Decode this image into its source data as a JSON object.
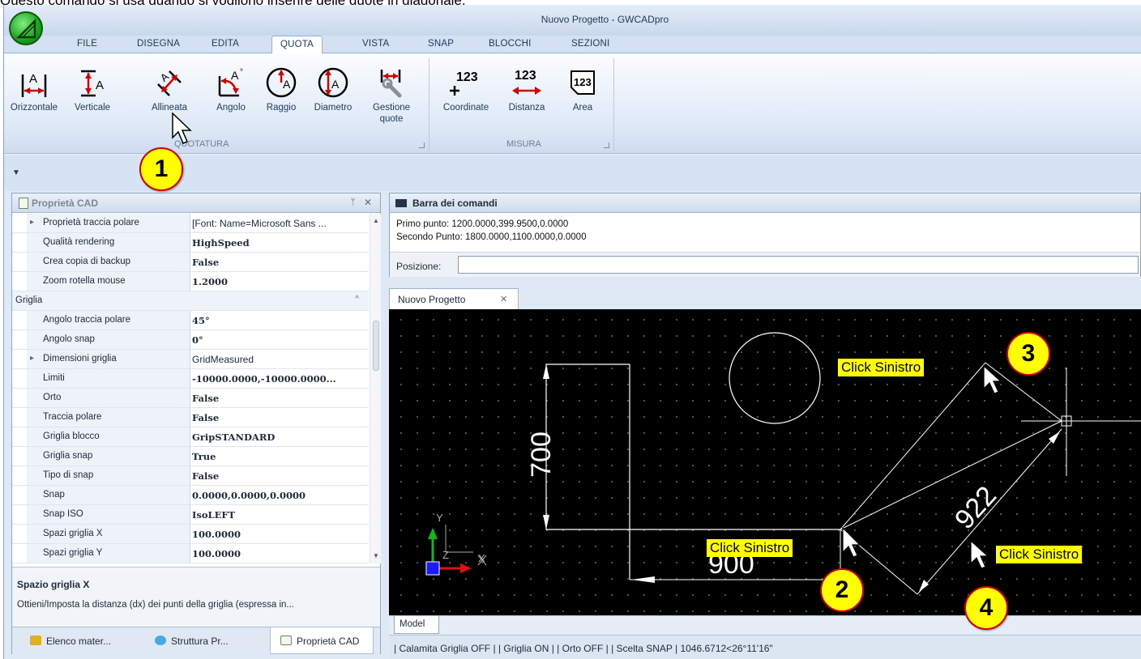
{
  "caption": "Questo comando si usa quando si vogliono inserire delle quote in diagonale.",
  "window": {
    "title": "Nuovo Progetto - GWCADpro"
  },
  "ribbon_tabs": [
    "FILE",
    "DISEGNA",
    "EDITA",
    "QUOTA",
    "VISTA",
    "SNAP",
    "BLOCCHI",
    "SEZIONI"
  ],
  "active_tab": "QUOTA",
  "ribbon": {
    "quotatura_buttons": [
      {
        "label": "Orizzontale",
        "icon": "horizontal-dimension-icon"
      },
      {
        "label": "Verticale",
        "icon": "vertical-dimension-icon"
      },
      {
        "label": "Allineata",
        "icon": "aligned-dimension-icon"
      },
      {
        "label": "Angolo",
        "icon": "angle-dimension-icon"
      },
      {
        "label": "Raggio",
        "icon": "radius-dimension-icon"
      },
      {
        "label": "Diametro",
        "icon": "diameter-dimension-icon"
      },
      {
        "label": "Gestione quote",
        "icon": "dimension-manager-icon"
      }
    ],
    "quotatura_label": "QUOTATURA",
    "misura_buttons": [
      {
        "label": "Coordinate",
        "icon": "coordinate-icon",
        "glyph": "123"
      },
      {
        "label": "Distanza",
        "icon": "distance-icon",
        "glyph": "123"
      },
      {
        "label": "Area",
        "icon": "area-icon",
        "glyph": "123"
      }
    ],
    "misura_label": "MISURA"
  },
  "properties_panel": {
    "title": "Proprietà CAD",
    "rows": [
      {
        "key": "Proprietà traccia polare",
        "value": "[Font: Name=Microsoft Sans ...",
        "bold": false,
        "expandable": true
      },
      {
        "key": "Qualità rendering",
        "value": "HighSpeed",
        "bold": true
      },
      {
        "key": "Crea copia di backup",
        "value": "False",
        "bold": true
      },
      {
        "key": "Zoom rotella mouse",
        "value": "1.2000",
        "bold": true
      },
      {
        "category": "Griglia"
      },
      {
        "key": "Angolo traccia polare",
        "value": "45°",
        "bold": true
      },
      {
        "key": "Angolo snap",
        "value": "0°",
        "bold": true
      },
      {
        "key": "Dimensioni griglia",
        "value": "GridMeasured",
        "bold": false,
        "expandable": true
      },
      {
        "key": "Limiti",
        "value": "-10000.0000,-10000.0000...",
        "bold": true
      },
      {
        "key": "Orto",
        "value": "False",
        "bold": true
      },
      {
        "key": "Traccia polare",
        "value": "False",
        "bold": true
      },
      {
        "key": "Griglia blocco",
        "value": "GripSTANDARD",
        "bold": true
      },
      {
        "key": "Griglia snap",
        "value": "True",
        "bold": true
      },
      {
        "key": "Tipo di snap",
        "value": "False",
        "bold": true
      },
      {
        "key": "Snap",
        "value": "0.0000,0.0000,0.0000",
        "bold": true
      },
      {
        "key": "Snap ISO",
        "value": "IsoLEFT",
        "bold": true
      },
      {
        "key": "Spazi griglia X",
        "value": "100.0000",
        "bold": true
      },
      {
        "key": "Spazi griglia Y",
        "value": "100.0000",
        "bold": true
      }
    ],
    "description_title": "Spazio griglia X",
    "description_text": "Ottieni/Imposta la distanza (dx) dei punti della griglia (espressa in...",
    "bottom_tabs": [
      "Elenco mater...",
      "Struttura Pr...",
      "Proprietà CAD"
    ]
  },
  "command_bar": {
    "title": "Barra dei comandi",
    "lines": [
      "Primo punto: 1200.0000,399.9500,0.0000",
      "Secondo Punto: 1800.0000,1100.0000,0.0000"
    ],
    "position_label": "Posizione:",
    "position_value": ""
  },
  "document_tab": "Nuovo Progetto",
  "drawing": {
    "dim_vertical": "700",
    "dim_horizontal": "900",
    "dim_aligned": "922",
    "axis_y": "Y",
    "axis_x": "X",
    "axis_z": "Z"
  },
  "model_tab": "Model",
  "status_bar": "| Calamita Griglia OFF | | Griglia ON | | Orto OFF | | Scelta SNAP | 1046.6712<26°11'16\"",
  "annotations": {
    "steps": [
      "1",
      "2",
      "3",
      "4"
    ],
    "click_label": "Click Sinistro"
  }
}
